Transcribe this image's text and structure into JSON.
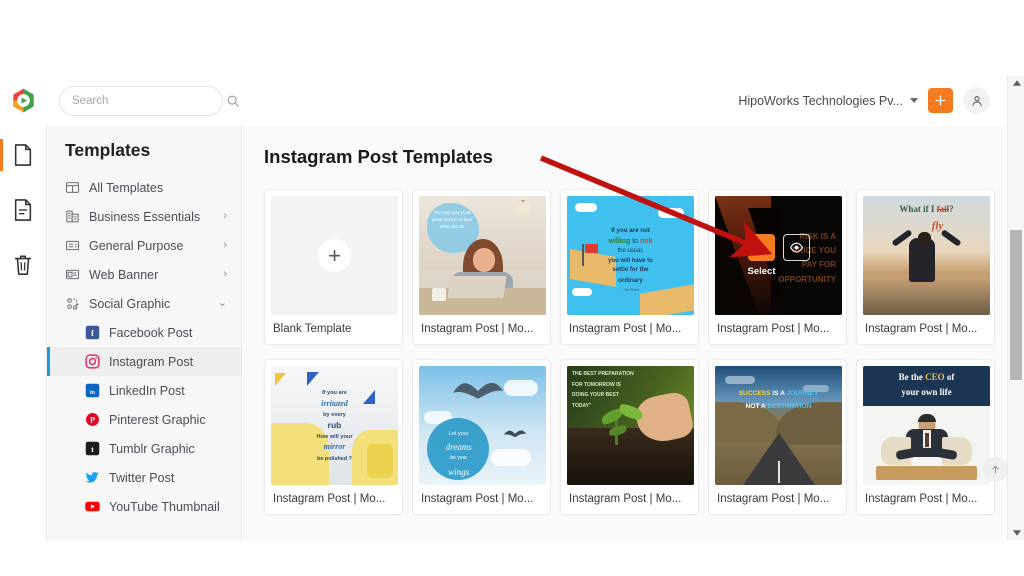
{
  "app": {
    "logo_name": "app-logo",
    "search": {
      "placeholder": "Search",
      "value": ""
    },
    "org": {
      "name": "HipoWorks Technologies Pv...",
      "chevron": "chevron-down-icon"
    },
    "add_button_label": "+",
    "avatar_label": "account-icon"
  },
  "rail": {
    "items": [
      {
        "icon": "document-icon",
        "name": "rail-item-designs",
        "active": true
      },
      {
        "icon": "document-lines-icon",
        "name": "rail-item-templates",
        "active": false
      },
      {
        "icon": "trash-icon",
        "name": "rail-item-trash",
        "active": false
      }
    ]
  },
  "sidebar": {
    "title": "Templates",
    "items": [
      {
        "label": "All Templates",
        "icon": "grid-templates-icon",
        "arrow": "",
        "sub": false,
        "active": false
      },
      {
        "label": "Business Essentials",
        "icon": "building-icon",
        "arrow": "›",
        "sub": false,
        "active": false
      },
      {
        "label": "General Purpose",
        "icon": "list-card-icon",
        "arrow": "›",
        "sub": false,
        "active": false
      },
      {
        "label": "Web Banner",
        "icon": "banner-icon",
        "arrow": "›",
        "sub": false,
        "active": false
      },
      {
        "label": "Social Graphic",
        "icon": "social-share-icon",
        "arrow": "⌄",
        "sub": false,
        "active": false
      },
      {
        "label": "Facebook Post",
        "icon": "facebook-icon",
        "arrow": "",
        "sub": true,
        "active": false
      },
      {
        "label": "Instagram Post",
        "icon": "instagram-icon",
        "arrow": "",
        "sub": true,
        "active": true
      },
      {
        "label": "LinkedIn Post",
        "icon": "linkedin-icon",
        "arrow": "",
        "sub": true,
        "active": false
      },
      {
        "label": "Pinterest Graphic",
        "icon": "pinterest-icon",
        "arrow": "",
        "sub": true,
        "active": false
      },
      {
        "label": "Tumblr Graphic",
        "icon": "tumblr-icon",
        "arrow": "",
        "sub": true,
        "active": false
      },
      {
        "label": "Twitter Post",
        "icon": "twitter-icon",
        "arrow": "",
        "sub": true,
        "active": false
      },
      {
        "label": "YouTube Thumbnail",
        "icon": "youtube-icon",
        "arrow": "",
        "sub": true,
        "active": false
      }
    ]
  },
  "main": {
    "heading": "Instagram Post Templates",
    "overlay": {
      "select_label": "Select",
      "select_icon": "cursor-arrow-icon",
      "preview_icon": "eye-icon"
    },
    "to_top_label": "↑",
    "cards": [
      {
        "label": "Blank Template",
        "kind": "blank",
        "hovered": false
      },
      {
        "label": "Instagram Post | Mo...",
        "kind": "woman-laptop",
        "hovered": false
      },
      {
        "label": "Instagram Post | Mo...",
        "kind": "risk-flag",
        "hovered": false
      },
      {
        "label": "Instagram Post | Mo...",
        "kind": "climber-dark",
        "hovered": true
      },
      {
        "label": "Instagram Post | Mo...",
        "kind": "what-if-i-fail",
        "hovered": false
      },
      {
        "label": "Instagram Post | Mo...",
        "kind": "irritated-rub",
        "hovered": false
      },
      {
        "label": "Instagram Post | Mo...",
        "kind": "dreams-wings",
        "hovered": false
      },
      {
        "label": "Instagram Post | Mo...",
        "kind": "seedling",
        "hovered": false
      },
      {
        "label": "Instagram Post | Mo...",
        "kind": "success-road",
        "hovered": false
      },
      {
        "label": "Instagram Post | Mo...",
        "kind": "be-the-ceo",
        "hovered": false
      }
    ],
    "thumb_text": {
      "woman_laptop": "The only way to do great work is to love what you do",
      "risk_flag_line1": "If you are not",
      "risk_flag_willing": "willing",
      "risk_flag_to": "to",
      "risk_flag_risk": "risk",
      "risk_flag_line2": "the usual,",
      "risk_flag_line3": "you will have to",
      "risk_flag_line4": "settle for the",
      "risk_flag_line5": "ordinary",
      "risk_flag_author": "Jim Rohn",
      "climber_line1": "RISK IS A",
      "climber_line2": "PRICE YOU",
      "climber_line3": "PAY FOR",
      "climber_line4": "OPPORTUNITY",
      "fail_line1": "What if I",
      "fail_strike": "fail",
      "fail_q": "?",
      "fail_fly": "fly",
      "irritated_l1": "If you are",
      "irritated_l2": "irritated",
      "irritated_l3": "by every",
      "irritated_l4": "rub",
      "irritated_l5": "How will your",
      "irritated_l6": "mirror",
      "irritated_l7": "be polished ?",
      "dreams_l1": "Let your",
      "dreams_l2": "dreams",
      "dreams_l3": "be your",
      "dreams_l4": "wings",
      "seedling_l1": "THE BEST PREPARATION",
      "seedling_l2": "FOR TOMORROW IS",
      "seedling_l3": "DOING YOUR BEST",
      "seedling_l4": "TODAY\"",
      "road_l1a": "SUCCESS",
      "road_l1b": "IS A",
      "road_l1c": "JOURNEY",
      "road_l2a": "NOT A",
      "road_l2b": "DESTINATION",
      "ceo_l1a": "Be the",
      "ceo_l1b": "CEO",
      "ceo_l1c": "of",
      "ceo_l2": "your own life"
    }
  },
  "scrollbar": {
    "up_arrow": "▲",
    "down_arrow": "▼"
  },
  "colors": {
    "accent_orange": "#f47b20",
    "active_blue": "#1a9ddb",
    "annotation_red": "#c1110f"
  }
}
